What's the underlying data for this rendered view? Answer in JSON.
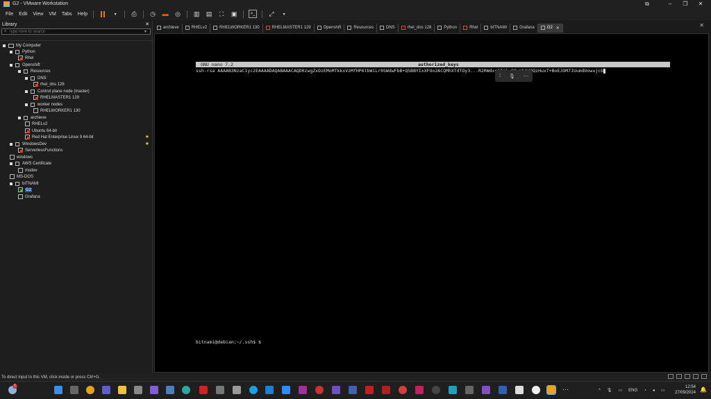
{
  "window": {
    "title": "G2 - VMware Workstation"
  },
  "menu": [
    "File",
    "Edit",
    "View",
    "VM",
    "Tabs",
    "Help"
  ],
  "library": {
    "title": "Library",
    "search_placeholder": "Type here to search",
    "tree": [
      {
        "label": "My Computer",
        "icon": "computer-icon",
        "level": 0,
        "kind": "pc"
      },
      {
        "label": "Python",
        "icon": "folder-icon",
        "level": 1,
        "kind": "folder"
      },
      {
        "label": "Rhel",
        "icon": "vm-icon",
        "level": 2,
        "kind": "vm-red"
      },
      {
        "label": "Openshift",
        "icon": "folder-icon",
        "level": 1,
        "kind": "folder"
      },
      {
        "label": "Resources",
        "icon": "folder-icon",
        "level": 2,
        "kind": "folder"
      },
      {
        "label": "DNS",
        "icon": "folder-icon",
        "level": 3,
        "kind": "folder"
      },
      {
        "label": "rhel_dns 128",
        "icon": "vm-icon",
        "level": 4,
        "kind": "vm-red"
      },
      {
        "label": "Control plane node (master)",
        "icon": "folder-icon",
        "level": 3,
        "kind": "folder"
      },
      {
        "label": "RHELMASTER1 129",
        "icon": "vm-icon",
        "level": 4,
        "kind": "vm-red"
      },
      {
        "label": "worker nodes",
        "icon": "folder-icon",
        "level": 3,
        "kind": "folder"
      },
      {
        "label": "RHELWORKER1 130",
        "icon": "vm-icon",
        "level": 4,
        "kind": "vm"
      },
      {
        "label": "archieve",
        "icon": "folder-icon",
        "level": 2,
        "kind": "folder"
      },
      {
        "label": "RHELv2",
        "icon": "vm-icon",
        "level": 3,
        "kind": "vm"
      },
      {
        "label": "Ubuntu 64-bit",
        "icon": "vm-icon",
        "level": 3,
        "kind": "vm-red"
      },
      {
        "label": "Red Hat Enterprise Linux 9 64-bit",
        "icon": "vm-icon",
        "level": 3,
        "kind": "vm-red",
        "starred": true
      },
      {
        "label": "WindowsDev",
        "icon": "folder-icon",
        "level": 1,
        "kind": "folder",
        "starred": true
      },
      {
        "label": "ServerlessFunctions",
        "icon": "vm-icon",
        "level": 2,
        "kind": "vm-red"
      },
      {
        "label": "windows",
        "icon": "vm-icon",
        "level": 1,
        "kind": "vm"
      },
      {
        "label": "AWS Certificate",
        "icon": "folder-icon",
        "level": 1,
        "kind": "folder"
      },
      {
        "label": "msdev",
        "icon": "vm-icon",
        "level": 2,
        "kind": "vm"
      },
      {
        "label": "MS-DOS",
        "icon": "vm-icon",
        "level": 1,
        "kind": "vm"
      },
      {
        "label": "bITNAMI",
        "icon": "folder-icon",
        "level": 1,
        "kind": "folder"
      },
      {
        "label": "G2",
        "icon": "vm-icon",
        "level": 2,
        "kind": "vm-green",
        "selected": true
      },
      {
        "label": "Grafana",
        "icon": "vm-icon",
        "level": 2,
        "kind": "vm"
      }
    ]
  },
  "tabs": [
    {
      "label": "archieve",
      "red": false
    },
    {
      "label": "RHELv2",
      "red": false
    },
    {
      "label": "RHELWORKER1 130",
      "red": false
    },
    {
      "label": "RHELMASTER1 129",
      "red": true
    },
    {
      "label": "Openshift",
      "red": false
    },
    {
      "label": "Resources",
      "red": false
    },
    {
      "label": "DNS",
      "red": false
    },
    {
      "label": "rhel_dns 128",
      "red": true
    },
    {
      "label": "Python",
      "red": false
    },
    {
      "label": "Rhel",
      "red": true
    },
    {
      "label": "bITNAMI",
      "red": false
    },
    {
      "label": "Grafana",
      "red": false
    },
    {
      "label": "G2",
      "red": false,
      "active": true
    }
  ],
  "terminal": {
    "nano_version": "GNU nano 7.2",
    "file_name": "authorized_keys",
    "content_line": "ssh-rsa AAAAB3NzaC1yc2EAAAADAQABAAACAQD0zwgZxDzEMoMTkkxVzMfHP6tbWiLr0SWdwFbB+QSBBYIxXFUo2ACQMhXTdTOy3...R2RWdxsGFi5xQ9vmbtVOQzHuxT+BoEJOM7JUumdUowujcb",
    "prompt": "bitnami@debian:~/.ssh$ $"
  },
  "status_bar": {
    "text": "To direct input to this VM, click inside or press Ctrl+G."
  },
  "taskbar": {
    "language": "ENG",
    "time": "12:54",
    "date": "27/09/2024",
    "notification_count": "1"
  }
}
